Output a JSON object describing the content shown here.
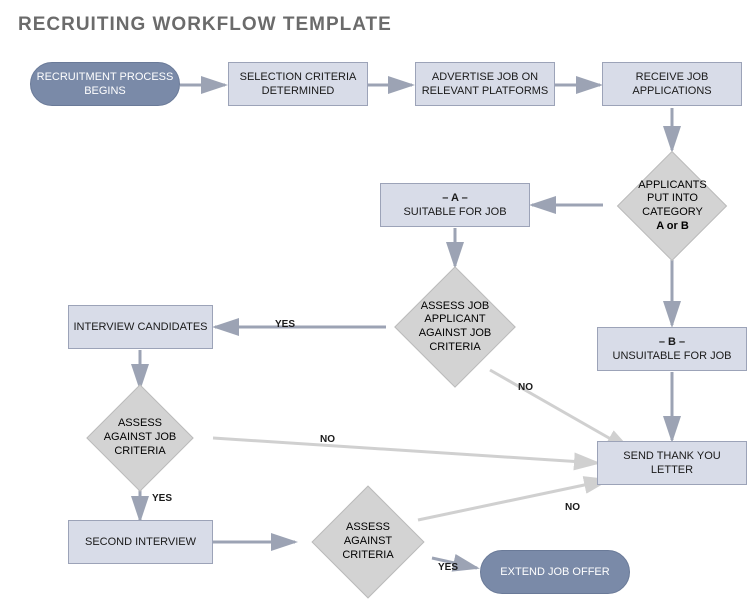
{
  "title": "RECRUITING WORKFLOW TEMPLATE",
  "nodes": {
    "start": "RECRUITMENT PROCESS BEGINS",
    "criteria": "SELECTION CRITERIA DETERMINED",
    "advertise": "ADVERTISE JOB ON RELEVANT PLATFORMS",
    "receive": "RECEIVE JOB APPLICATIONS",
    "categorize_l1": "APPLICANTS",
    "categorize_l2": "PUT INTO",
    "categorize_l3": "CATEGORY",
    "categorize_l4": "A or B",
    "suitable_l1": "– A –",
    "suitable_l2": "SUITABLE FOR JOB",
    "unsuitable_l1": "– B –",
    "unsuitable_l2": "UNSUITABLE FOR JOB",
    "assess1_l1": "ASSESS JOB",
    "assess1_l2": "APPLICANT",
    "assess1_l3": "AGAINST JOB",
    "assess1_l4": "CRITERIA",
    "interview": "INTERVIEW CANDIDATES",
    "assess2_l1": "ASSESS",
    "assess2_l2": "AGAINST JOB",
    "assess2_l3": "CRITERIA",
    "second_interview": "SECOND INTERVIEW",
    "assess3_l1": "ASSESS",
    "assess3_l2": "AGAINST",
    "assess3_l3": "CRITERIA",
    "thankyou": "SEND THANK YOU LETTER",
    "offer": "EXTEND JOB OFFER"
  },
  "labels": {
    "yes": "YES",
    "no": "NO"
  }
}
